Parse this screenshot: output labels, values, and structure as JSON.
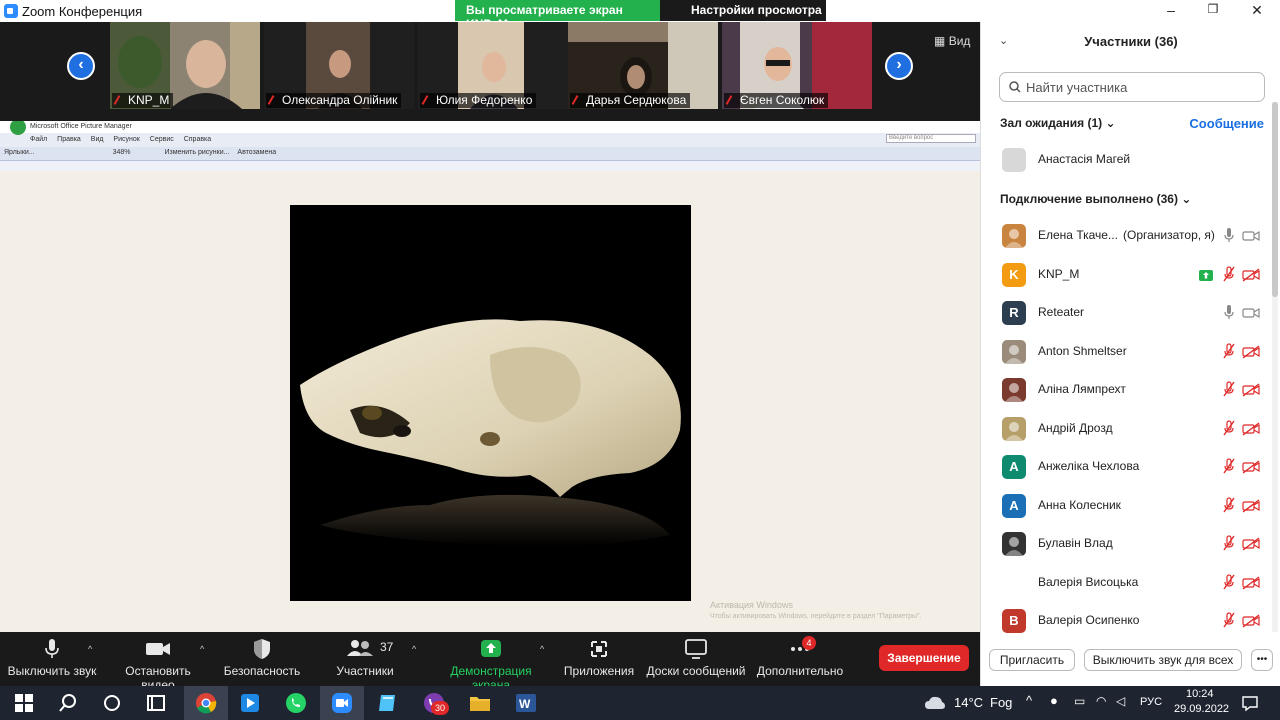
{
  "window": {
    "title": "Zoom Конференция"
  },
  "share_banner": {
    "text": "Вы просматриваете экран KNP_M",
    "view_settings": "Настройки просмотра"
  },
  "gallery": {
    "view_label": "Вид",
    "tiles": [
      "KNP_M",
      "Олександра Олійник",
      "Юлия Федоренко",
      "Дарья Сердюкова",
      "Євген Соколюк"
    ]
  },
  "shared_app": {
    "title": "Microsoft Office Picture Manager",
    "menu": [
      "Файл",
      "Правка",
      "Вид",
      "Рисунок",
      "Сервис",
      "Справка"
    ],
    "toolbar": [
      "Ярлыки...",
      "348%",
      "Изменить рисунки...",
      "Автозамена"
    ],
    "ask_placeholder": "Введите вопрос",
    "activation_title": "Активация Windows",
    "activation_sub": "Чтобы активировать Windows, перейдите в раздел \"Параметры\"."
  },
  "toolbar": {
    "mute": "Выключить звук",
    "video": "Остановить видео",
    "security": "Безопасность",
    "participants": "Участники",
    "participants_count": "37",
    "share": "Демонстрация экрана",
    "apps": "Приложения",
    "whiteboards": "Доски сообщений",
    "more": "Дополнительно",
    "more_badge": "4",
    "end": "Завершение"
  },
  "panel": {
    "title": "Участники (36)",
    "search_placeholder": "Найти участника",
    "waiting_section": "Зал ожидания (1)",
    "message_link": "Сообщение",
    "waiting": [
      {
        "name": "Анастасія Магей"
      }
    ],
    "joined_section": "Подключение выполнено (36)",
    "participants": [
      {
        "name": "Елена Ткаче...",
        "role": "(Организатор, я)",
        "avatar": "photo",
        "color": "#c9843f",
        "mic": "on",
        "cam": "on"
      },
      {
        "name": "KNP_M",
        "avatar": "K",
        "color": "#f39c12",
        "mic": "muted",
        "cam": "off",
        "sharing": true
      },
      {
        "name": "Reteater",
        "avatar": "R",
        "color": "#2c3e50",
        "mic": "on",
        "cam": "on"
      },
      {
        "name": "Anton Shmeltser",
        "avatar": "photo",
        "color": "#9a8b7a",
        "mic": "muted",
        "cam": "off"
      },
      {
        "name": "Аліна Лямпрехт",
        "avatar": "photo",
        "color": "#7a3b2e",
        "mic": "muted",
        "cam": "off"
      },
      {
        "name": "Андрій Дрозд",
        "avatar": "photo",
        "color": "#b79f6a",
        "mic": "muted",
        "cam": "off"
      },
      {
        "name": "Анжеліка Чехлова",
        "avatar": "А",
        "color": "#0e8a6e",
        "mic": "muted",
        "cam": "off"
      },
      {
        "name": "Анна Колесник",
        "avatar": "А",
        "color": "#1a6fb5",
        "mic": "muted",
        "cam": "off"
      },
      {
        "name": "Булавін Влад",
        "avatar": "photo",
        "color": "#333333",
        "mic": "muted",
        "cam": "off"
      },
      {
        "name": "Валерія Висоцька",
        "avatar": "",
        "color": "#ffffff",
        "mic": "muted",
        "cam": "off"
      },
      {
        "name": "Валерія Осипенко",
        "avatar": "В",
        "color": "#c0392b",
        "mic": "muted",
        "cam": "off"
      }
    ],
    "invite": "Пригласить",
    "mute_all": "Выключить звук для всех"
  },
  "taskbar": {
    "weather_temp": "14°C",
    "weather_desc": "Fog",
    "lang": "РУС",
    "time": "10:24",
    "date": "29.09.2022",
    "viber_badge": "30"
  }
}
